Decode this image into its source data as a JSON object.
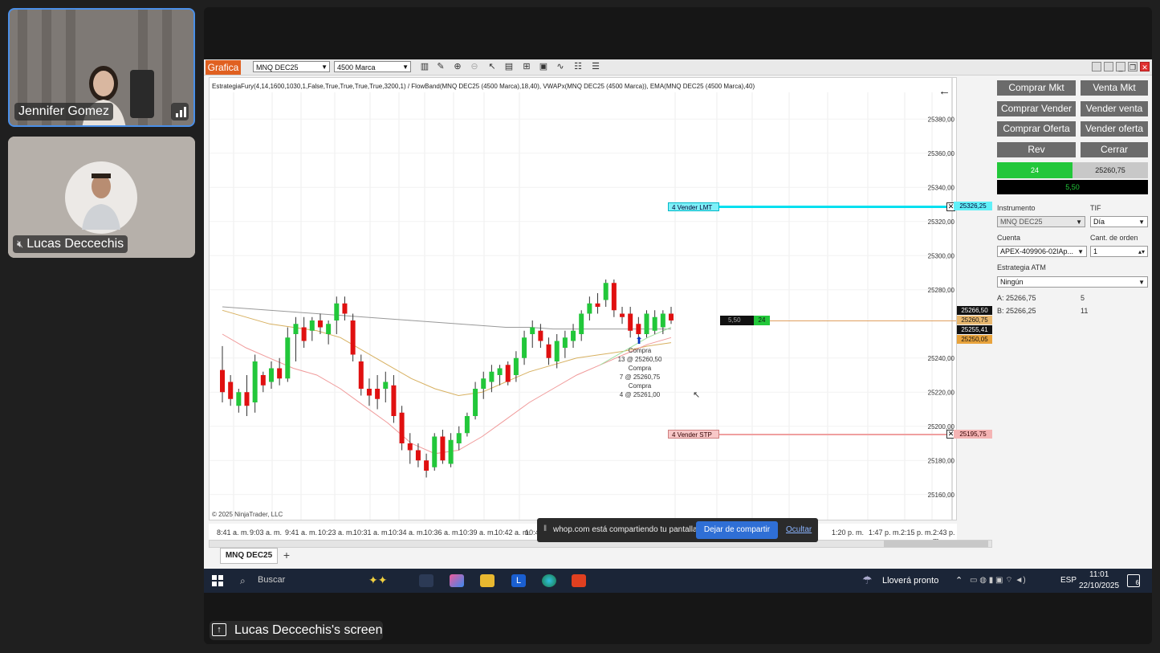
{
  "participants": [
    {
      "name": "Jennifer Gomez",
      "role": "active-speaker"
    },
    {
      "name": "Lucas Deccechis",
      "muted": true
    }
  ],
  "screen_share_label": "Lucas Deccechis's screen",
  "ninjatrader": {
    "tab_label": "Grafica",
    "instrument_select": "MNQ DEC25",
    "bar_type_select": "4500 Marca",
    "indicator_line": "EstrategiaFury(4,14,1600,1030,1,False,True,True,True,True,3200,1) / FlowBand(MNQ DEC25 (4500 Marca),18,40), VWAPx(MNQ DEC25 (4500 Marca)), EMA(MNQ DEC25 (4500 Marca),40)",
    "copyright": "© 2025 NinjaTrader, LLC",
    "price_ticks": [
      "25380,00",
      "25360,00",
      "25340,00",
      "25320,00",
      "25300,00",
      "25280,00",
      "25240,00",
      "25220,00",
      "25200,00",
      "25180,00",
      "25160,00"
    ],
    "time_ticks": [
      "8:41 a. m.",
      "9:03 a. m.",
      "9:41 a. m.",
      "10:23 a. m.",
      "10:31 a. m.",
      "10:34 a. m.",
      "10:36 a. m.",
      "10:39 a. m.",
      "10:42 a. m.",
      "10:46",
      "1:20 p. m.",
      "1:47 p. m.",
      "2:15 p. m.",
      "2:43 p. m."
    ],
    "order_lmt_label": "4  Vender LMT",
    "order_lmt_price": "25326,25",
    "order_stp_label": "4  Vender STP",
    "order_stp_price": "25195,75",
    "position_pnl": "5,50",
    "position_qty": "24",
    "price_badges": [
      {
        "text": "25266,50",
        "color": "#111111"
      },
      {
        "text": "25260,75",
        "color": "#e8b870"
      },
      {
        "text": "25255,41",
        "color": "#111111"
      },
      {
        "text": "25250,05",
        "color": "#e8a33c"
      }
    ],
    "fills": [
      {
        "title": "Compra",
        "detail": "13 @ 25260,50"
      },
      {
        "title": "Compra",
        "detail": "7 @ 25260,75"
      },
      {
        "title": "Compra",
        "detail": "4 @ 25261,00"
      }
    ],
    "bottom_tab": "MNQ DEC25",
    "plus_tab": "+"
  },
  "order_panel": {
    "buttons": [
      "Comprar Mkt",
      "Venta Mkt",
      "Comprar Vender",
      "Vender venta",
      "Comprar Oferta",
      "Vender oferta",
      "Rev",
      "Cerrar"
    ],
    "position_qty": "24",
    "avg_price": "25260,75",
    "unrealized": "5,50",
    "instrument_label": "Instrumento",
    "instrument_value": "MNQ DEC25",
    "tif_label": "TIF",
    "tif_value": "Día",
    "account_label": "Cuenta",
    "account_value": "APEX-409906-02IAp...",
    "qty_label": "Cant. de orden",
    "qty_value": "1",
    "atm_label": "Estrategia ATM",
    "atm_value": "Ningún",
    "ask": "A:  25266,75",
    "ask_size": "5",
    "bid": "B:  25266,25",
    "bid_size": "11"
  },
  "share_banner": {
    "text": "whop.com está compartiendo tu pantalla.",
    "stop_button": "Dejar de compartir",
    "hide_link": "Ocultar"
  },
  "taskbar": {
    "search_placeholder": "Buscar",
    "weather": "Lloverá pronto",
    "language": "ESP",
    "time": "11:01",
    "date": "22/10/2025",
    "notif_count": "6"
  },
  "colors": {
    "bull": "#22c73a",
    "bear": "#e01010",
    "lmt_line": "#00e0f0",
    "stp_line": "#f0a0a0",
    "accent_tab": "#e06020"
  },
  "chart_data": {
    "type": "candlestick",
    "bar_type": "4500 Marca",
    "instrument": "MNQ DEC25",
    "candles": [
      {
        "o": 25233,
        "h": 25247,
        "l": 25214,
        "c": 25220,
        "dir": "down"
      },
      {
        "o": 25226,
        "h": 25230,
        "l": 25212,
        "c": 25216,
        "dir": "down"
      },
      {
        "o": 25212,
        "h": 25222,
        "l": 25208,
        "c": 25220,
        "dir": "up"
      },
      {
        "o": 25220,
        "h": 25230,
        "l": 25206,
        "c": 25212,
        "dir": "down"
      },
      {
        "o": 25214,
        "h": 25242,
        "l": 25208,
        "c": 25238,
        "dir": "up"
      },
      {
        "o": 25230,
        "h": 25232,
        "l": 25220,
        "c": 25224,
        "dir": "down"
      },
      {
        "o": 25226,
        "h": 25238,
        "l": 25222,
        "c": 25234,
        "dir": "up"
      },
      {
        "o": 25234,
        "h": 25240,
        "l": 25224,
        "c": 25228,
        "dir": "down"
      },
      {
        "o": 25228,
        "h": 25258,
        "l": 25226,
        "c": 25252,
        "dir": "up"
      },
      {
        "o": 25254,
        "h": 25264,
        "l": 25238,
        "c": 25260,
        "dir": "up"
      },
      {
        "o": 25258,
        "h": 25264,
        "l": 25246,
        "c": 25250,
        "dir": "down"
      },
      {
        "o": 25256,
        "h": 25264,
        "l": 25250,
        "c": 25262,
        "dir": "up"
      },
      {
        "o": 25262,
        "h": 25266,
        "l": 25254,
        "c": 25258,
        "dir": "down"
      },
      {
        "o": 25254,
        "h": 25262,
        "l": 25248,
        "c": 25260,
        "dir": "up"
      },
      {
        "o": 25262,
        "h": 25276,
        "l": 25254,
        "c": 25272,
        "dir": "up"
      },
      {
        "o": 25272,
        "h": 25276,
        "l": 25262,
        "c": 25266,
        "dir": "down"
      },
      {
        "o": 25262,
        "h": 25266,
        "l": 25238,
        "c": 25242,
        "dir": "down"
      },
      {
        "o": 25238,
        "h": 25242,
        "l": 25218,
        "c": 25222,
        "dir": "down"
      },
      {
        "o": 25222,
        "h": 25228,
        "l": 25212,
        "c": 25218,
        "dir": "down"
      },
      {
        "o": 25222,
        "h": 25230,
        "l": 25210,
        "c": 25216,
        "dir": "down"
      },
      {
        "o": 25222,
        "h": 25232,
        "l": 25214,
        "c": 25226,
        "dir": "up"
      },
      {
        "o": 25224,
        "h": 25230,
        "l": 25202,
        "c": 25206,
        "dir": "down"
      },
      {
        "o": 25208,
        "h": 25212,
        "l": 25186,
        "c": 25190,
        "dir": "down"
      },
      {
        "o": 25190,
        "h": 25196,
        "l": 25178,
        "c": 25186,
        "dir": "down"
      },
      {
        "o": 25186,
        "h": 25190,
        "l": 25176,
        "c": 25180,
        "dir": "down"
      },
      {
        "o": 25180,
        "h": 25184,
        "l": 25170,
        "c": 25174,
        "dir": "down"
      },
      {
        "o": 25176,
        "h": 25196,
        "l": 25174,
        "c": 25194,
        "dir": "up"
      },
      {
        "o": 25194,
        "h": 25198,
        "l": 25178,
        "c": 25180,
        "dir": "down"
      },
      {
        "o": 25178,
        "h": 25196,
        "l": 25176,
        "c": 25192,
        "dir": "up"
      },
      {
        "o": 25190,
        "h": 25200,
        "l": 25186,
        "c": 25196,
        "dir": "up"
      },
      {
        "o": 25196,
        "h": 25208,
        "l": 25194,
        "c": 25206,
        "dir": "up"
      },
      {
        "o": 25206,
        "h": 25226,
        "l": 25204,
        "c": 25222,
        "dir": "up"
      },
      {
        "o": 25222,
        "h": 25232,
        "l": 25216,
        "c": 25228,
        "dir": "up"
      },
      {
        "o": 25226,
        "h": 25236,
        "l": 25220,
        "c": 25232,
        "dir": "up"
      },
      {
        "o": 25230,
        "h": 25236,
        "l": 25224,
        "c": 25234,
        "dir": "up"
      },
      {
        "o": 25236,
        "h": 25238,
        "l": 25224,
        "c": 25226,
        "dir": "down"
      },
      {
        "o": 25230,
        "h": 25244,
        "l": 25226,
        "c": 25240,
        "dir": "up"
      },
      {
        "o": 25240,
        "h": 25256,
        "l": 25236,
        "c": 25252,
        "dir": "up"
      },
      {
        "o": 25254,
        "h": 25262,
        "l": 25246,
        "c": 25258,
        "dir": "up"
      },
      {
        "o": 25256,
        "h": 25260,
        "l": 25246,
        "c": 25250,
        "dir": "down"
      },
      {
        "o": 25248,
        "h": 25252,
        "l": 25236,
        "c": 25240,
        "dir": "down"
      },
      {
        "o": 25238,
        "h": 25254,
        "l": 25234,
        "c": 25250,
        "dir": "up"
      },
      {
        "o": 25246,
        "h": 25256,
        "l": 25240,
        "c": 25252,
        "dir": "up"
      },
      {
        "o": 25250,
        "h": 25260,
        "l": 25246,
        "c": 25256,
        "dir": "up"
      },
      {
        "o": 25254,
        "h": 25268,
        "l": 25250,
        "c": 25266,
        "dir": "up"
      },
      {
        "o": 25266,
        "h": 25276,
        "l": 25262,
        "c": 25272,
        "dir": "up"
      },
      {
        "o": 25272,
        "h": 25278,
        "l": 25266,
        "c": 25270,
        "dir": "down"
      },
      {
        "o": 25274,
        "h": 25286,
        "l": 25270,
        "c": 25284,
        "dir": "up"
      },
      {
        "o": 25284,
        "h": 25286,
        "l": 25264,
        "c": 25268,
        "dir": "down"
      },
      {
        "o": 25266,
        "h": 25270,
        "l": 25260,
        "c": 25264,
        "dir": "down"
      },
      {
        "o": 25266,
        "h": 25270,
        "l": 25252,
        "c": 25256,
        "dir": "down"
      },
      {
        "o": 25260,
        "h": 25264,
        "l": 25252,
        "c": 25254,
        "dir": "down"
      },
      {
        "o": 25254,
        "h": 25268,
        "l": 25252,
        "c": 25266,
        "dir": "up"
      },
      {
        "o": 25256,
        "h": 25268,
        "l": 25254,
        "c": 25264,
        "dir": "up"
      },
      {
        "o": 25258,
        "h": 25268,
        "l": 25254,
        "c": 25266,
        "dir": "up"
      },
      {
        "o": 25266,
        "h": 25270,
        "l": 25260,
        "c": 25262,
        "dir": "down"
      }
    ],
    "lines": [
      {
        "name": "VWAP",
        "color": "#999999",
        "values": [
          25270,
          25269,
          25268,
          25267,
          25266,
          25265,
          25264,
          25263,
          25262,
          25261,
          25260,
          25259,
          25258,
          25258,
          25257,
          25257,
          25257,
          25257,
          25257,
          25257
        ]
      },
      {
        "name": "EMA",
        "color": "#d7b060",
        "values": [
          25268,
          25264,
          25260,
          25258,
          25256,
          25252,
          25244,
          25236,
          25228,
          25222,
          25218,
          25220,
          25226,
          25232,
          25236,
          25240,
          25242,
          25244,
          25247,
          25249
        ]
      },
      {
        "name": "FlowBand",
        "color": "#f09a9a",
        "values": [
          25254,
          25246,
          25240,
          25234,
          25230,
          25222,
          25212,
          25202,
          25190,
          25184,
          25186,
          25194,
          25204,
          25214,
          25222,
          25230,
          25236,
          25242,
          25248,
          25252
        ]
      },
      {
        "name": "Fast",
        "color": "#a0e0a0",
        "values": [
          null,
          null,
          null,
          null,
          null,
          null,
          null,
          null,
          null,
          null,
          null,
          null,
          null,
          null,
          null,
          null,
          25236,
          25244,
          25252,
          25258
        ]
      }
    ],
    "ylim": [
      25150,
      25390
    ]
  }
}
